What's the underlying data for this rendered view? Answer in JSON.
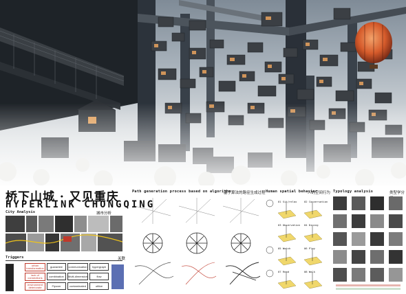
{
  "title_cn": "桥下山城 · 又见重庆",
  "title_en": "HYPERLINK CHONGQING",
  "city_analysis": {
    "en": "City Analysis",
    "cn": "城市分析"
  },
  "triggers": {
    "label": "Triggers",
    "cn_note": "关联"
  },
  "trigger_boxes": [
    "guarantee",
    "communication",
    "hypergraph",
    "combination",
    "Multi-dimension",
    "flow",
    "Flyover",
    "contaminated",
    "utilize"
  ],
  "trigger_red_boxes": [
    "urban transformation",
    "lack of connections",
    "environment deteriorate"
  ],
  "path_section": {
    "en": "Path generation process based on algorithm",
    "cn": "基于算法的路径生成过程"
  },
  "human_section": {
    "en": "Human spatial behavior",
    "cn": "人的空间行为"
  },
  "typology_section": {
    "en": "Typology analysis",
    "cn": "类型学分析"
  },
  "behaviors": [
    "01 Sit/relax",
    "02 Conversation",
    "03 Observation",
    "04 Dining",
    "05 Watch",
    "06 Play",
    "07 Read",
    "08 Walk"
  ],
  "colors": {
    "accent_red": "#c0392b",
    "ink": "#111111",
    "balloon_orange": "#e0763a"
  }
}
